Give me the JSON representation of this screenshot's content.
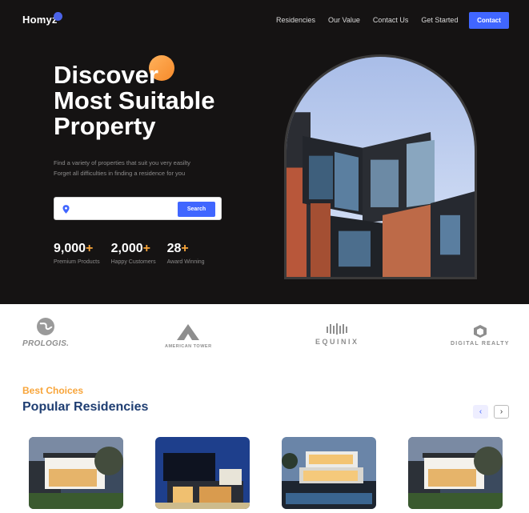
{
  "header": {
    "logo": "Homyz",
    "nav": [
      "Residencies",
      "Our Value",
      "Contact Us",
      "Get Started"
    ],
    "contact_label": "Contact"
  },
  "hero": {
    "title_lines": [
      "Discover",
      "Most Suitable",
      "Property"
    ],
    "subtitle_lines": [
      "Find a variety of properties that suit you very easilty",
      "Forget all difficulties in finding a residence for you"
    ],
    "search": {
      "value": "",
      "placeholder": "",
      "button_label": "Search"
    },
    "stats": [
      {
        "value": "9,000",
        "suffix": "+",
        "label": "Premium Products"
      },
      {
        "value": "2,000",
        "suffix": "+",
        "label": "Happy Customers"
      },
      {
        "value": "28",
        "suffix": "+",
        "label": "Award Winning"
      }
    ]
  },
  "brands": [
    "PROLOGIS.",
    "AMERICAN TOWER",
    "EQUINIX",
    "DIGITAL REALTY"
  ],
  "residencies": {
    "eyebrow": "Best Choices",
    "heading": "Popular Residencies",
    "prev_icon": "chevron-left-icon",
    "next_icon": "chevron-right-icon"
  },
  "colors": {
    "accent": "#4066ff",
    "orange": "#f8a53a",
    "navy": "#1f3e72",
    "hero_bg": "#151313"
  }
}
